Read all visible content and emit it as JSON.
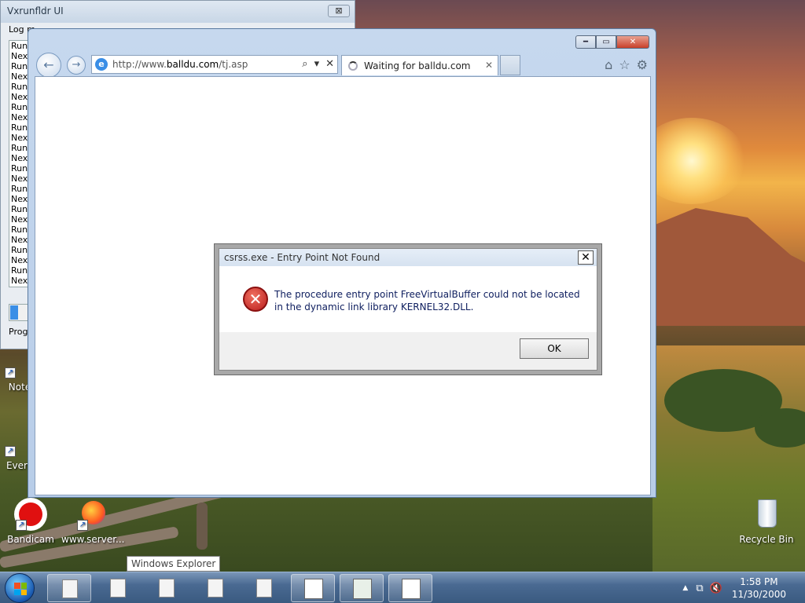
{
  "background_window": {
    "title": "Vxrunfldr UI",
    "close": "⊠",
    "menu": "Log m",
    "log_lines": [
      "Runi",
      "Next",
      "Runi",
      "Next",
      "Runi",
      "Next",
      "Runi",
      "Next",
      "Runi",
      "Next",
      "Runi",
      "Next",
      "Runi",
      "Next",
      "Runi",
      "Next",
      "Runi",
      "Next",
      "Runi",
      "Next",
      "Runi",
      "Next",
      "Runi",
      "Next"
    ],
    "progress_label": "Progr"
  },
  "browser": {
    "address": {
      "prefix": "http://www.",
      "domain": "balldu.com",
      "path": "/tj.asp"
    },
    "tab_label": "Waiting for balldu.com",
    "tab_close": "✕",
    "caption": {
      "minimize": "━",
      "maximize": "▭",
      "close": "✕"
    },
    "tools": {
      "home": "⌂",
      "favorites": "☆",
      "settings": "⚙"
    },
    "address_tools": {
      "search": "⌕",
      "dropdown": "▾",
      "stop": "✕"
    },
    "nav": {
      "back": "←",
      "forward": "→"
    }
  },
  "dialog": {
    "title": "csrss.exe - Entry Point Not Found",
    "close": "✕",
    "icon": "✕",
    "message": "The procedure entry point FreeVirtualBuffer could not be located in the dynamic link library KERNEL32.DLL.",
    "ok": "OK"
  },
  "desktop_icons": [
    {
      "label": "Note",
      "icon": "notepad-icon"
    },
    {
      "label": "Every",
      "icon": "everything-icon"
    },
    {
      "label": "Bandicam",
      "icon": "bandicam-icon"
    },
    {
      "label": "www.server...",
      "icon": "firefox-icon"
    },
    {
      "label": "Recycle Bin",
      "icon": "recycle-bin-icon"
    }
  ],
  "tooltip": "Windows Explorer",
  "taskbar": {
    "clock_time": "1:58 PM",
    "clock_date": "11/30/2000",
    "tray": {
      "up": "▲",
      "network": "⧉",
      "volume": "🔇"
    }
  }
}
